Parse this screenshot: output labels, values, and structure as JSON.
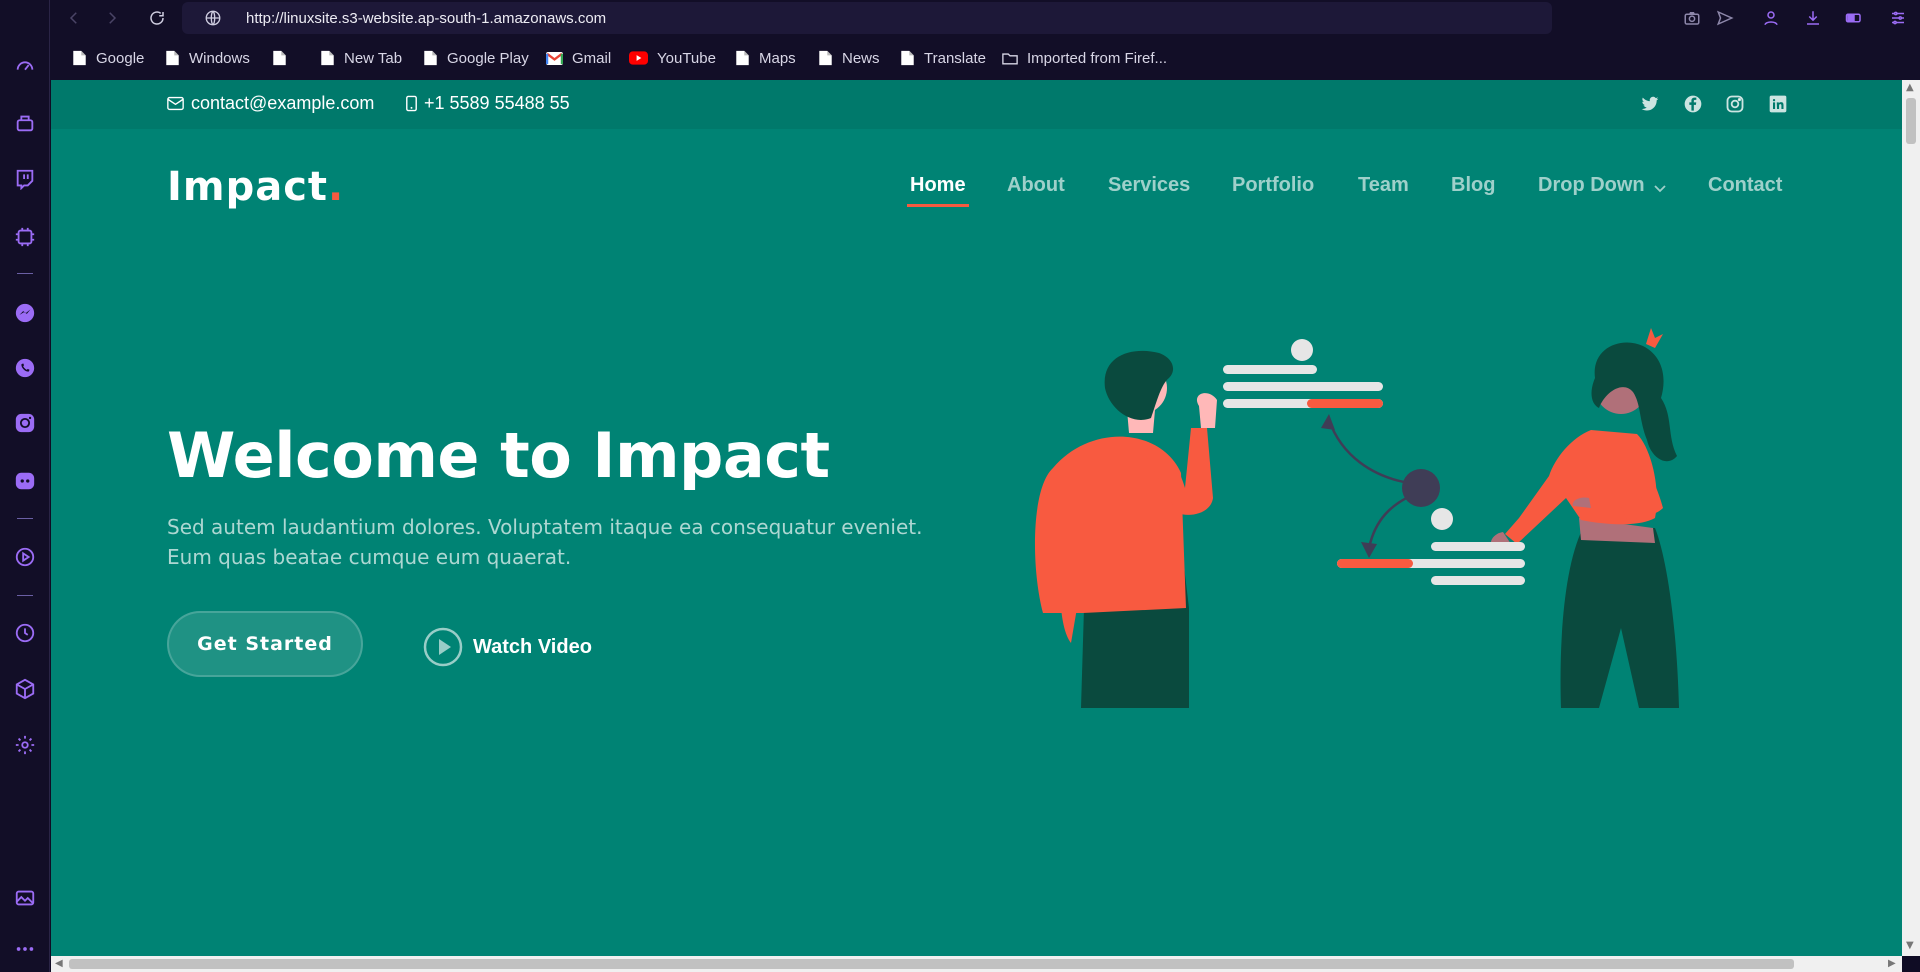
{
  "browser": {
    "url": "http://linuxsite.s3-website.ap-south-1.amazonaws.com",
    "bookmarks": [
      {
        "label": "Google",
        "icon": "page-icon"
      },
      {
        "label": "Windows",
        "icon": "page-icon"
      },
      {
        "label": "",
        "icon": "page-icon"
      },
      {
        "label": "New Tab",
        "icon": "page-icon"
      },
      {
        "label": "Google Play",
        "icon": "page-icon"
      },
      {
        "label": "Gmail",
        "icon": "gmail-icon"
      },
      {
        "label": "YouTube",
        "icon": "youtube-icon"
      },
      {
        "label": "Maps",
        "icon": "page-icon"
      },
      {
        "label": "News",
        "icon": "page-icon"
      },
      {
        "label": "Translate",
        "icon": "page-icon"
      },
      {
        "label": "Imported from Firef...",
        "icon": "folder-icon"
      }
    ],
    "sidebar_icons": [
      "speed-dial-icon",
      "bag-icon",
      "twitch-icon",
      "chip-icon",
      "messenger-icon",
      "whatsapp-icon",
      "instagram-icon",
      "discord-icon",
      "player-icon",
      "history-icon",
      "cube-icon",
      "settings-icon",
      "image-icon",
      "more-icon"
    ]
  },
  "site": {
    "topbar": {
      "email": "contact@example.com",
      "phone": "+1 5589 55488 55",
      "social": [
        "twitter-icon",
        "facebook-icon",
        "instagram-icon",
        "linkedin-icon"
      ]
    },
    "logo": {
      "text": "Impact",
      "dot": "."
    },
    "nav": [
      {
        "label": "Home",
        "active": true
      },
      {
        "label": "About"
      },
      {
        "label": "Services"
      },
      {
        "label": "Portfolio"
      },
      {
        "label": "Team"
      },
      {
        "label": "Blog"
      },
      {
        "label": "Drop Down"
      },
      {
        "label": "Contact"
      }
    ],
    "hero": {
      "title": "Welcome to Impact",
      "text": "Sed autem laudantium dolores. Voluptatem itaque ea consequatur eveniet. Eum quas beatae cumque eum quaerat.",
      "cta_primary": "Get Started",
      "cta_secondary": "Watch Video"
    }
  },
  "colors": {
    "page_bg": "#008374",
    "topbar_bg": "#00796b",
    "accent": "#f85a40",
    "browser_chrome": "#120e27",
    "sidebar_icon": "#9b6cf5"
  }
}
